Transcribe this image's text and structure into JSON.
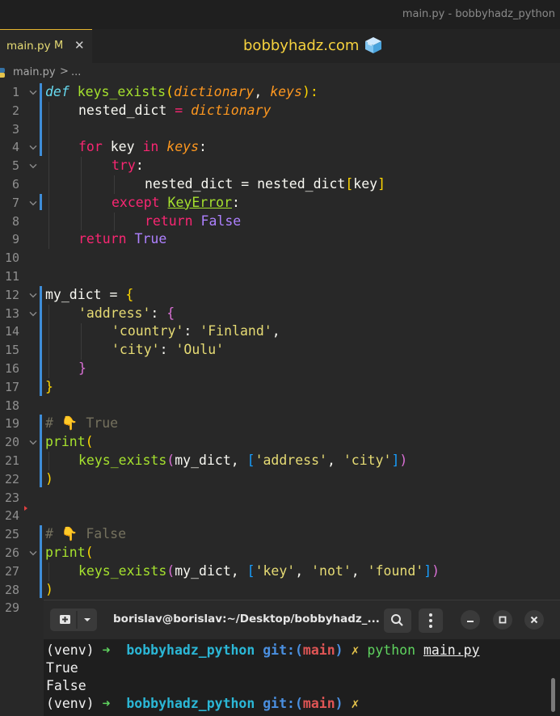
{
  "window": {
    "title": "main.py - bobbyhadz_python"
  },
  "tab": {
    "label": "main.py",
    "modified": "M",
    "close": "✕"
  },
  "watermark": {
    "text": "bobbyhadz.com"
  },
  "breadcrumb": {
    "file": "main.py",
    "separator": ">",
    "more": "..."
  },
  "editor": {
    "line_numbers": [
      "1",
      "2",
      "3",
      "4",
      "5",
      "6",
      "7",
      "8",
      "9",
      "10",
      "11",
      "12",
      "13",
      "14",
      "15",
      "16",
      "17",
      "18",
      "19",
      "20",
      "21",
      "22",
      "23",
      "24",
      "25",
      "26",
      "27",
      "28",
      "29"
    ],
    "tokens": {
      "l1": [
        "def",
        " ",
        "keys_exists",
        "(",
        "dictionary",
        ", ",
        "keys",
        "):"
      ],
      "l2": [
        "nested_dict",
        " = ",
        "dictionary"
      ],
      "l4": [
        "for",
        " key ",
        "in",
        " ",
        "keys",
        ":"
      ],
      "l5": [
        "try",
        ":"
      ],
      "l6": [
        "nested_dict = nested_dict",
        "[",
        "key",
        "]"
      ],
      "l7": [
        "except",
        " ",
        "KeyError",
        ":"
      ],
      "l8": [
        "return",
        " ",
        "False"
      ],
      "l9": [
        "return",
        " ",
        "True"
      ],
      "l12": [
        "my_dict = ",
        "{"
      ],
      "l13": [
        "'address'",
        ": ",
        "{"
      ],
      "l14": [
        "'country'",
        ": ",
        "'Finland'",
        ","
      ],
      "l15": [
        "'city'",
        ": ",
        "'Oulu'"
      ],
      "l16": [
        "}"
      ],
      "l17": [
        "}"
      ],
      "l19": [
        "# 👇 True"
      ],
      "l20": [
        "print",
        "("
      ],
      "l21": [
        "keys_exists",
        "(",
        "my_dict, ",
        "[",
        "'address'",
        ", ",
        "'city'",
        "]",
        ")"
      ],
      "l22": [
        ")"
      ],
      "l25": [
        "# 👇 False"
      ],
      "l26": [
        "print",
        "("
      ],
      "l27": [
        "keys_exists",
        "(",
        "my_dict, ",
        "[",
        "'key'",
        ", ",
        "'not'",
        ", ",
        "'found'",
        "]",
        ")"
      ],
      "l28": [
        ")"
      ]
    }
  },
  "terminal": {
    "title": "borislav@borislav:~/Desktop/bobbyhadz_...",
    "new_tab_icon": "new-terminal-icon",
    "lines": {
      "p1": [
        "(venv) ",
        "➜",
        "  ",
        "bobbyhadz_python",
        " ",
        "git:(",
        "main",
        ")",
        " ",
        "✗",
        " ",
        "python",
        " ",
        "main.py"
      ],
      "o1": "True",
      "o2": "False",
      "p2": [
        "(venv) ",
        "➜",
        "  ",
        "bobbyhadz_python",
        " ",
        "git:(",
        "main",
        ")",
        " ",
        "✗"
      ]
    }
  },
  "colors": {
    "accent": "#e5b52f",
    "modified_bar": "#3e8dd8",
    "keyword": "#f92672",
    "function": "#a6e22e",
    "string": "#e6db74",
    "constant": "#ae81ff"
  }
}
